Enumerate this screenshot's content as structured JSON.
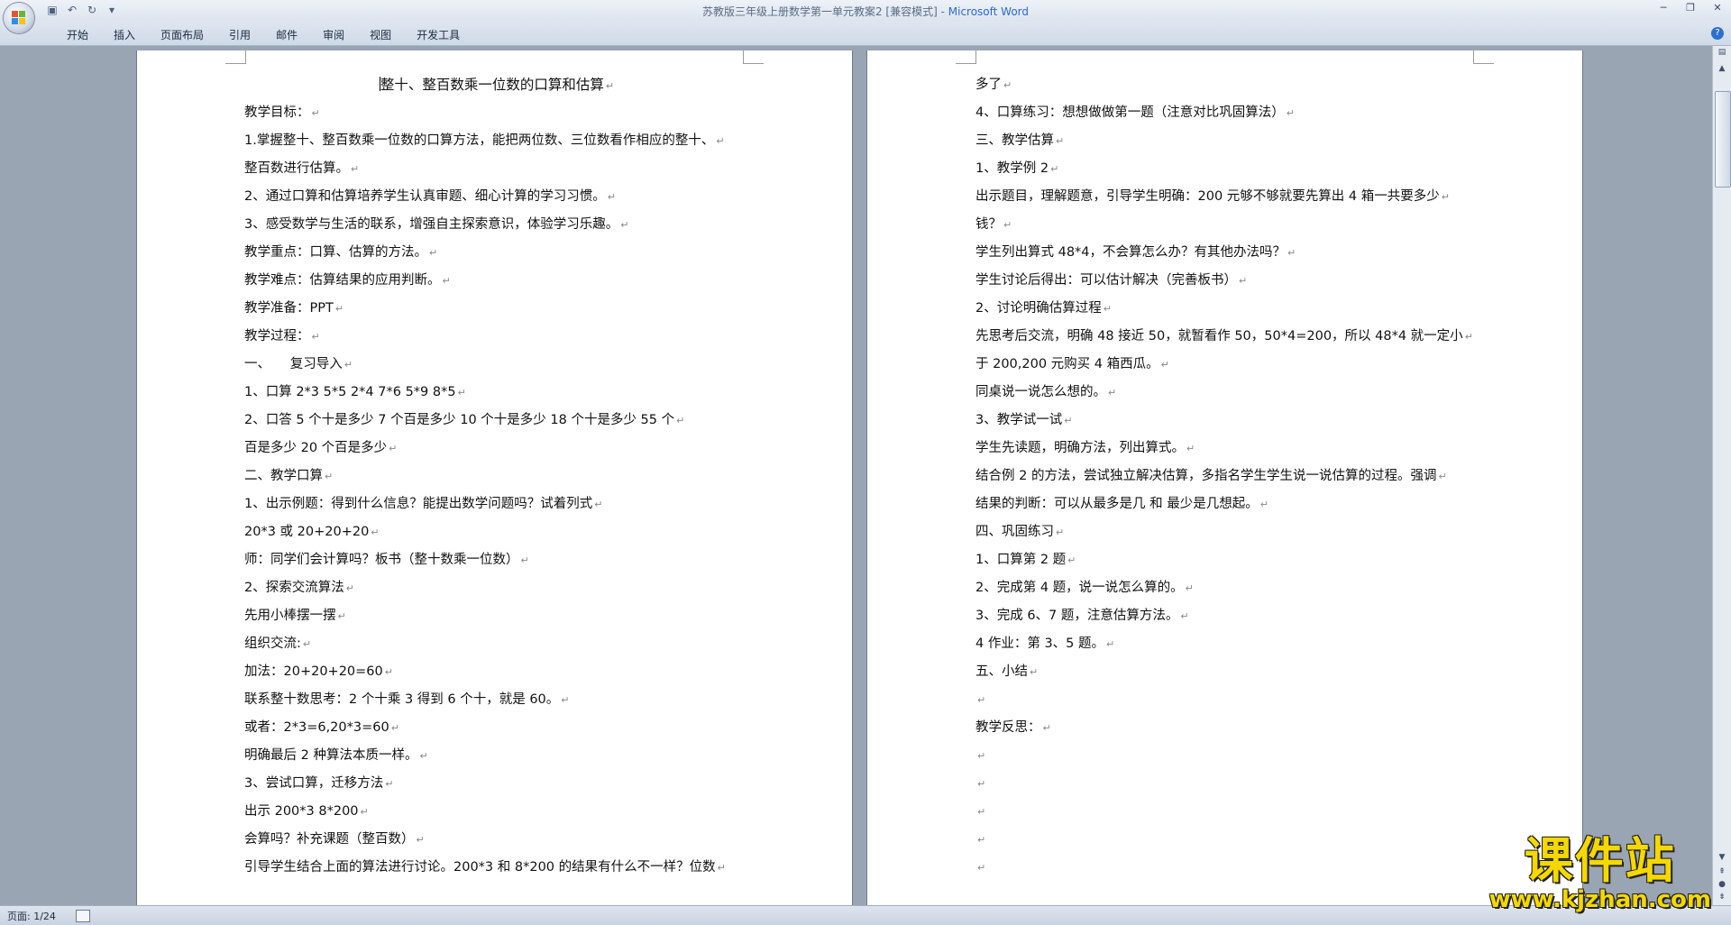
{
  "window": {
    "title_doc": "苏教版三年级上册数学第一单元教案2 [兼容模式] - ",
    "title_app": "Microsoft Word"
  },
  "ribbon": {
    "tabs": [
      "开始",
      "插入",
      "页面布局",
      "引用",
      "邮件",
      "审阅",
      "视图",
      "开发工具"
    ]
  },
  "page1": {
    "title": "整十、整百数乘一位数的口算和估算",
    "lines": [
      "教学目标：",
      "1.掌握整十、整百数乘一位数的口算方法，能把两位数、三位数看作相应的整十、",
      "整百数进行估算。",
      "2、通过口算和估算培养学生认真审题、细心计算的学习习惯。",
      "3、感受数学与生活的联系，增强自主探索意识，体验学习乐趣。",
      "教学重点：口算、估算的方法。",
      "教学难点：估算结果的应用判断。",
      "教学准备：PPT",
      "教学过程：",
      "一、　　复习导入",
      "1、口算 2*3  5*5    2*4    7*6    5*9    8*5",
      "2、口答  5 个十是多少    7 个百是多少    10 个十是多少    18 个十是多少    55 个",
      "百是多少  20 个百是多少",
      "二、教学口算",
      "1、出示例题：得到什么信息？能提出数学问题吗？试着列式",
      "20*3 或 20+20+20",
      "师：同学们会计算吗？板书（整十数乘一位数）",
      "2、探索交流算法",
      "先用小棒摆一摆",
      "组织交流:",
      "加法：20+20+20=60",
      "联系整十数思考：2 个十乘 3 得到 6 个十，就是 60。",
      "或者：2*3=6,20*3=60",
      "明确最后 2 种算法本质一样。",
      "3、尝试口算，迁移方法",
      "出示 200*3  8*200",
      "会算吗？补充课题（整百数）",
      "引导学生结合上面的算法进行讨论。200*3 和 8*200 的结果有什么不一样？位数"
    ]
  },
  "page2": {
    "lines": [
      "多了",
      "4、口算练习：想想做做第一题（注意对比巩固算法）",
      "三、教学估算",
      "1、教学例 2",
      "出示题目，理解题意，引导学生明确：200 元够不够就要先算出 4 箱一共要多少",
      "钱？",
      "学生列出算式 48*4，不会算怎么办？有其他办法吗？",
      "学生讨论后得出：可以估计解决（完善板书）",
      "2、讨论明确估算过程",
      "先思考后交流，明确 48 接近 50，就暂看作 50，50*4=200，所以 48*4 就一定小",
      "于 200,200 元购买 4 箱西瓜。",
      "同桌说一说怎么想的。",
      "3、教学试一试",
      "学生先读题，明确方法，列出算式。",
      "结合例 2 的方法，尝试独立解决估算，多指名学生学生说一说估算的过程。强调",
      "结果的判断：可以从最多是几 和  最少是几想起。",
      "四、巩固练习",
      "1、口算第 2 题",
      "2、完成第 4 题，说一说怎么算的。",
      "3、完成 6、7 题，注意估算方法。",
      "4 作业：第 3、5 题。",
      "五、小结",
      "",
      "教学反思：",
      "",
      "",
      "",
      "",
      ""
    ]
  },
  "status": {
    "page_info": "页面: 1/24"
  },
  "watermark": {
    "big": "课件站",
    "small": "www.kjzhan.com"
  },
  "colors": {
    "app_title": "#2a6ad6",
    "watermark": "#f4d800"
  }
}
